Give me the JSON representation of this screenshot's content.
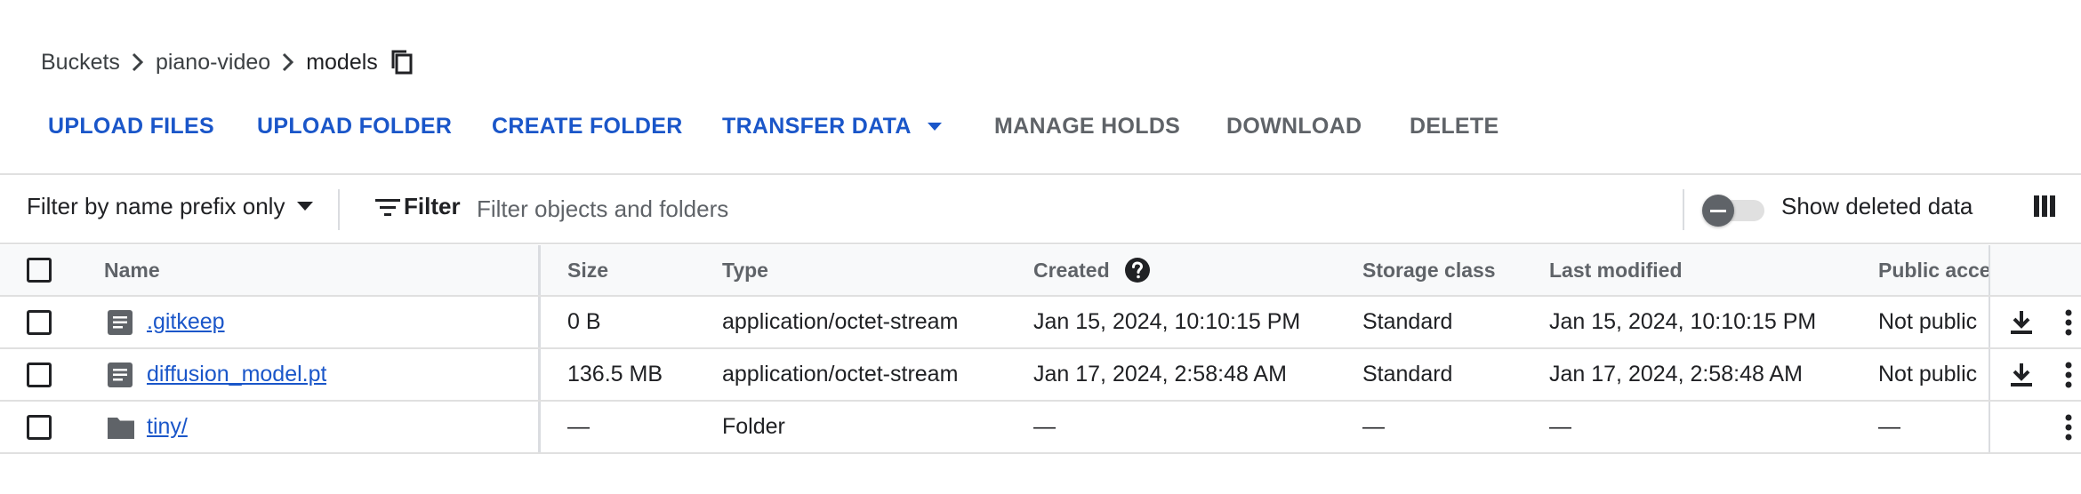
{
  "breadcrumb": {
    "root": "Buckets",
    "bucket": "piano-video",
    "current": "models"
  },
  "toolbar": {
    "upload_files": "UPLOAD FILES",
    "upload_folder": "UPLOAD FOLDER",
    "create_folder": "CREATE FOLDER",
    "transfer_data": "TRANSFER DATA",
    "manage_holds": "MANAGE HOLDS",
    "download": "DOWNLOAD",
    "delete": "DELETE"
  },
  "filter_bar": {
    "prefix_label": "Filter by name prefix only",
    "filter_label": "Filter",
    "placeholder": "Filter objects and folders",
    "show_deleted": "Show deleted data",
    "show_deleted_on": false
  },
  "table": {
    "headers": {
      "name": "Name",
      "size": "Size",
      "type": "Type",
      "created": "Created",
      "storage": "Storage class",
      "modified": "Last modified",
      "public": "Public access"
    },
    "rows": [
      {
        "name": ".gitkeep",
        "icon": "file-icon",
        "size": "0 B",
        "type": "application/octet-stream",
        "created": "Jan 15, 2024, 10:10:15 PM",
        "storage": "Standard",
        "modified": "Jan 15, 2024, 10:10:15 PM",
        "public": "Not public"
      },
      {
        "name": "diffusion_model.pt",
        "icon": "file-icon",
        "size": "136.5 MB",
        "type": "application/octet-stream",
        "created": "Jan 17, 2024, 2:58:48 AM",
        "storage": "Standard",
        "modified": "Jan 17, 2024, 2:58:48 AM",
        "public": "Not public"
      },
      {
        "name": "tiny/",
        "icon": "folder-icon",
        "size": "—",
        "type": "Folder",
        "created": "—",
        "storage": "—",
        "modified": "—",
        "public": "—"
      }
    ]
  },
  "colors": {
    "link_blue": "#1a56c9",
    "disabled_gray": "#5f6368",
    "border": "#e0e0e0"
  }
}
